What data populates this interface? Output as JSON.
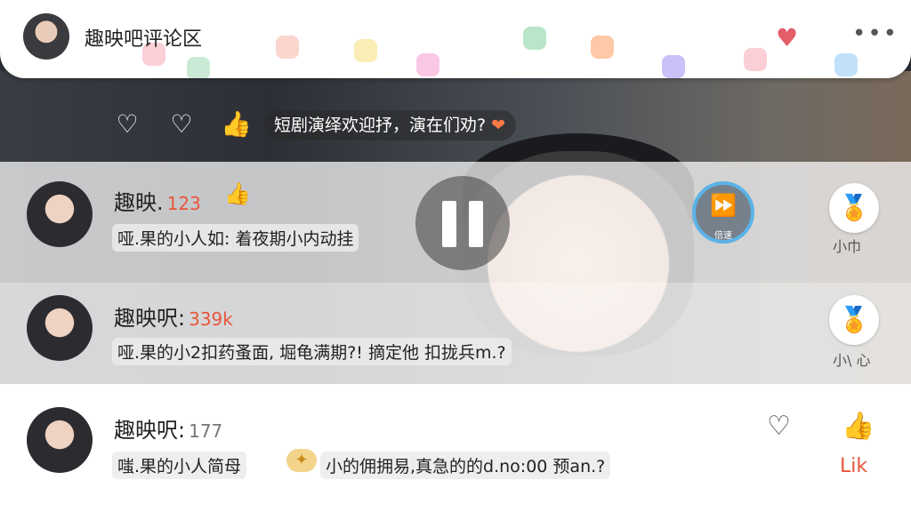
{
  "header": {
    "title": "趣映吧评论区",
    "heart_icon": "♥",
    "more_label": "•••"
  },
  "video": {
    "caption": "短剧演绎欢迎抒，演在们劝?",
    "caption_heart": "❤",
    "fast_forward_label": "倍速"
  },
  "comments": [
    {
      "name": "趣映.",
      "count": "123",
      "text": "哑.果的小人如: 着夜期小内动挂"
    },
    {
      "name": "趣映呎:",
      "count": "339k",
      "text": "哑.果的小2扣药蚤面, 堀龟满期?! 摘定他 扣拢兵m.?"
    },
    {
      "name": "趣映呎:",
      "count": "177",
      "text_before": "嗤.果的小人简母",
      "text_after": "小的佣拥易,真急的的d.no:00 预an.?"
    }
  ],
  "medals": [
    {
      "label": "小巾"
    },
    {
      "label": "小\\ 心"
    }
  ],
  "like": {
    "label": "Lik"
  },
  "colors": {
    "accent": "#e84a3b",
    "count": "#e8563b",
    "ff_ring": "#5bb3e8"
  }
}
